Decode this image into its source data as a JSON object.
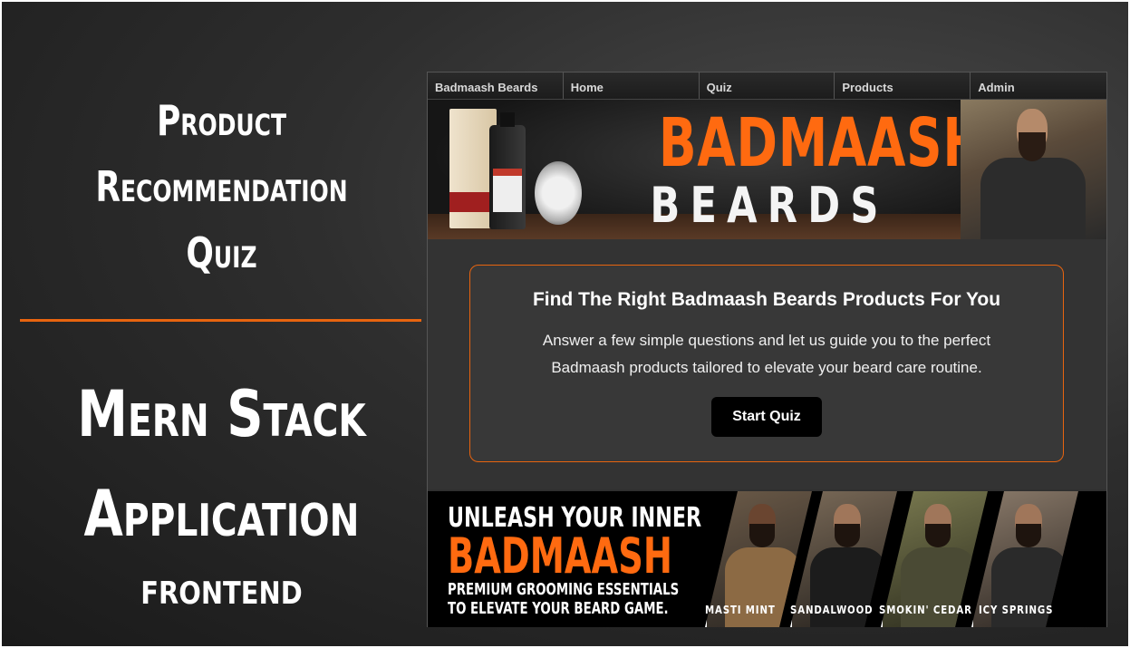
{
  "left": {
    "quiz_title_lines": [
      "Product",
      "Recommendation",
      "Quiz"
    ],
    "stack_title_lines": [
      "Mern Stack",
      "Application"
    ],
    "frontend_label": "frontend",
    "accent_color": "#e8640f"
  },
  "nav": {
    "items": [
      "Badmaash Beards",
      "Home",
      "Quiz",
      "Products",
      "Admin"
    ]
  },
  "hero": {
    "brand_line1": "BADMAASH",
    "brand_line2": "BEARDS",
    "brand_color": "#ff6a10"
  },
  "card": {
    "title": "Find The Right Badmaash Beards Products For You",
    "description": "Answer a few simple questions and let us guide you to the perfect Badmaash products tailored to elevate your beard care routine.",
    "button_label": "Start Quiz"
  },
  "promo": {
    "line1": "UNLEASH YOUR INNER",
    "line2": "BADMAASH",
    "line3a": "PREMIUM GROOMING ESSENTIALS",
    "line3b": "TO ELEVATE YOUR BEARD GAME.",
    "panels": [
      "MASTI MINT",
      "SANDALWOOD",
      "SMOKIN' CEDAR",
      "ICY SPRINGS"
    ]
  }
}
